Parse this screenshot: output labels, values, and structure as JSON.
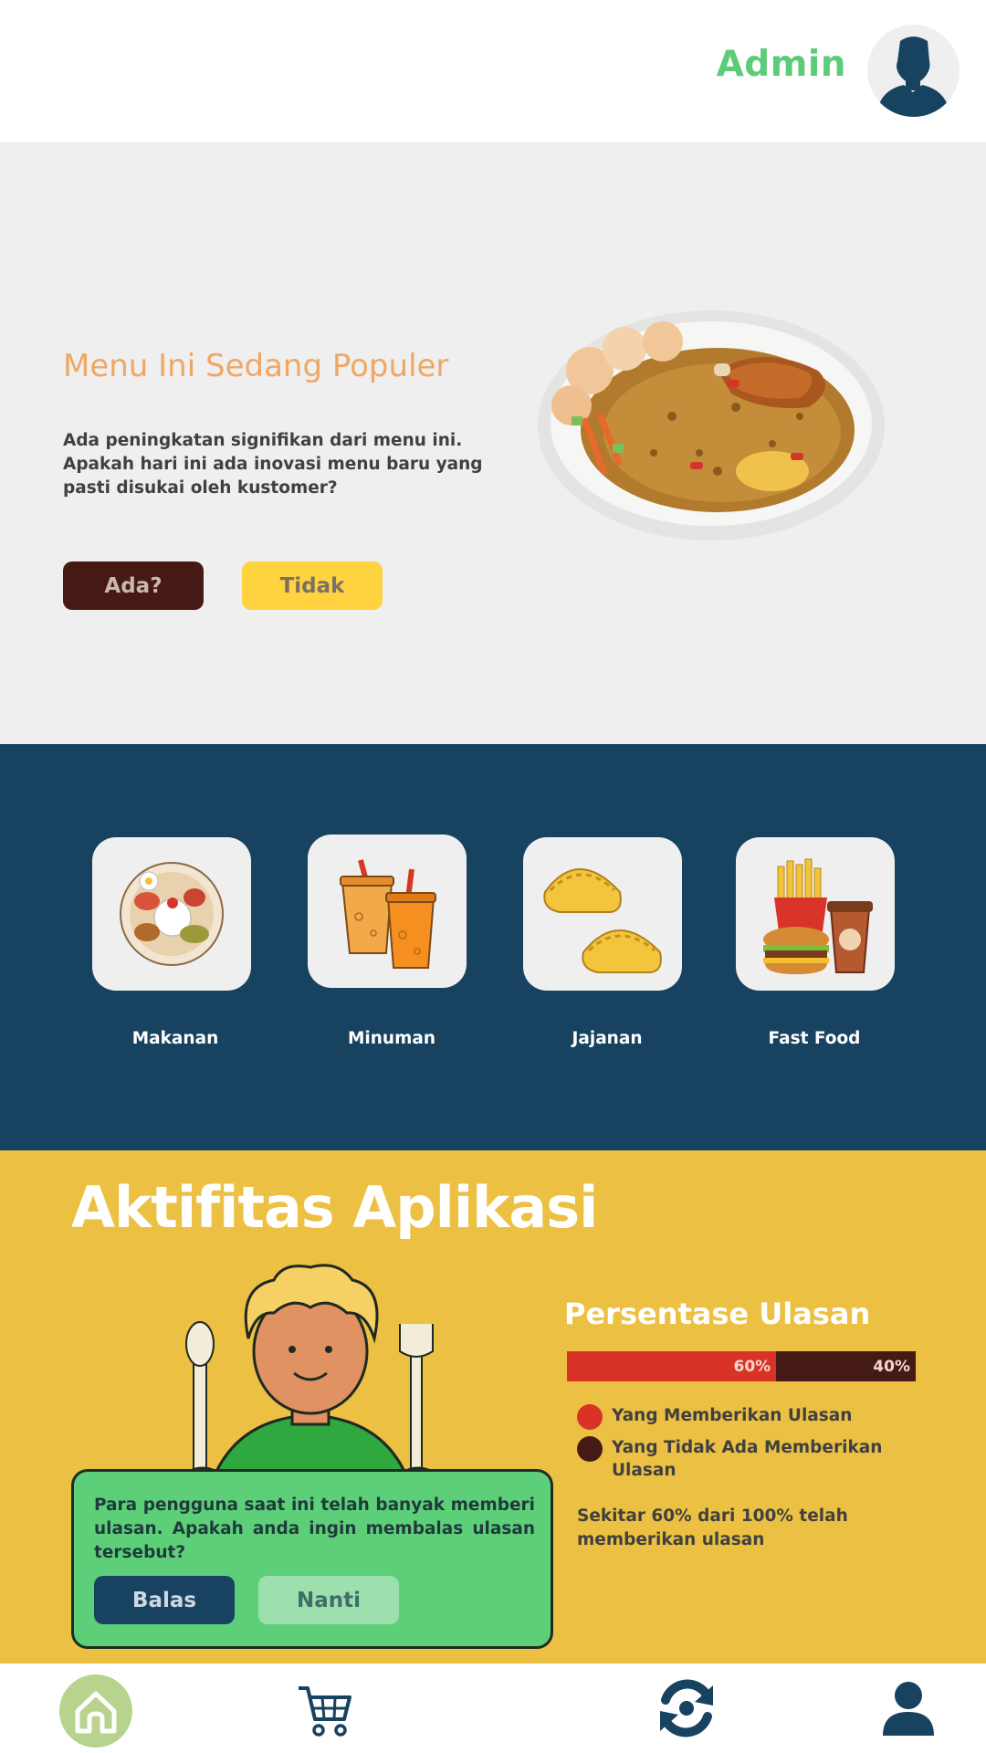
{
  "header": {
    "admin_label": "Admin",
    "avatar_icon": "user-silhouette-icon"
  },
  "hero": {
    "title": "Menu Ini Sedang Populer",
    "description": "Ada peningkatan signifikan dari menu ini. Apakah hari ini ada inovasi menu baru yang pasti disukai oleh kustomer?",
    "button_yes": "Ada?",
    "button_no": "Tidak",
    "image": "fried-rice-plate"
  },
  "categories": [
    {
      "label": "Makanan",
      "icon": "rice-plate-icon"
    },
    {
      "label": "Minuman",
      "icon": "drinks-icon"
    },
    {
      "label": "Jajanan",
      "icon": "pastry-icon"
    },
    {
      "label": "Fast Food",
      "icon": "fast-food-icon"
    }
  ],
  "activity": {
    "title": "Aktifitas Aplikasi",
    "review_title": "Persentase Ulasan",
    "bar": {
      "reviewed_percent": 60,
      "not_reviewed_percent": 40,
      "reviewed_label": "60%",
      "not_reviewed_label": "40%"
    },
    "legend": [
      {
        "label": "Yang Memberikan Ulasan",
        "color": "#d93328"
      },
      {
        "label": "Yang Tidak Ada Memberikan Ulasan",
        "color": "#451a14"
      }
    ],
    "note": "Sekitar 60% dari 100% telah memberikan ulasan",
    "popup": {
      "text": "Para pengguna saat ini telah banyak memberi ulasan. Apakah anda ingin membalas ulasan tersebut?",
      "button_reply": "Balas",
      "button_later": "Nanti"
    }
  },
  "bottom_nav": [
    {
      "icon": "home-icon",
      "active": true
    },
    {
      "icon": "cart-icon",
      "active": false
    },
    {
      "icon": "refresh-icon",
      "active": false
    },
    {
      "icon": "profile-icon",
      "active": false
    }
  ],
  "colors": {
    "accent_green": "#5dcc79",
    "navy": "#174260",
    "hero_title": "#efa765",
    "yellow": "#ecc042"
  }
}
